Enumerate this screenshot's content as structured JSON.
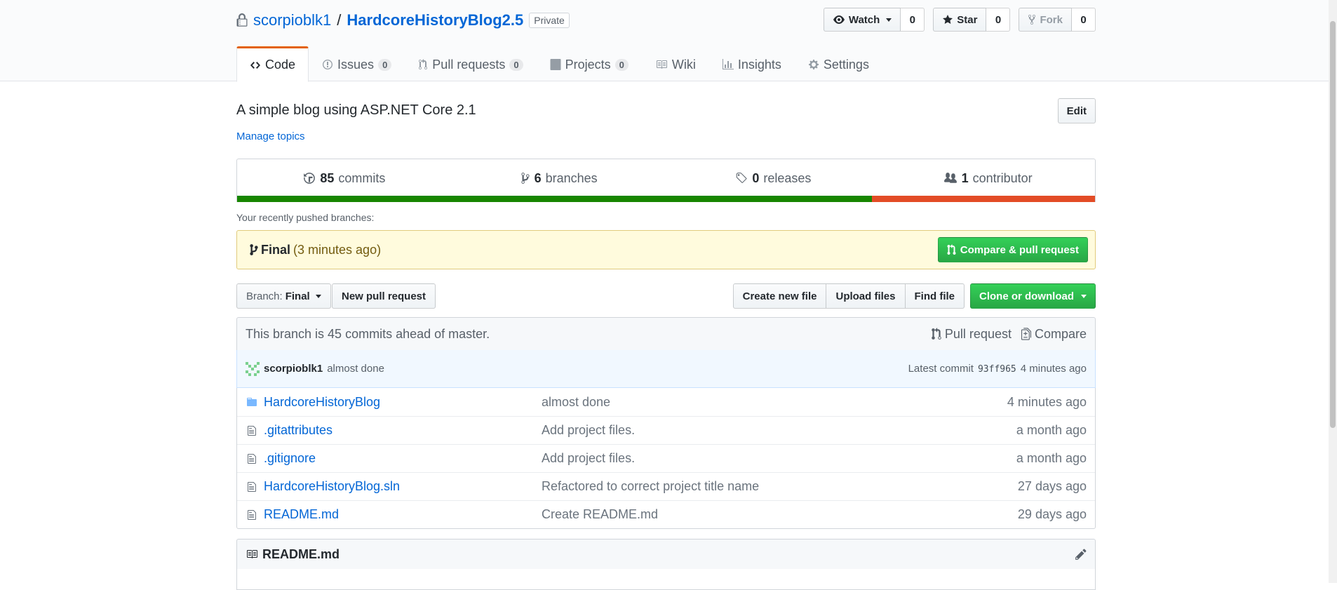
{
  "repo": {
    "owner": "scorpioblk1",
    "separator": "/",
    "name": "HardcoreHistoryBlog2.5",
    "visibility": "Private"
  },
  "actions": {
    "watch_label": "Watch",
    "watch_count": "0",
    "star_label": "Star",
    "star_count": "0",
    "fork_label": "Fork",
    "fork_count": "0"
  },
  "tabs": [
    {
      "label": "Code",
      "counter": null,
      "icon": "code-icon"
    },
    {
      "label": "Issues",
      "counter": "0",
      "icon": "issue-icon"
    },
    {
      "label": "Pull requests",
      "counter": "0",
      "icon": "pull-request-icon"
    },
    {
      "label": "Projects",
      "counter": "0",
      "icon": "project-icon"
    },
    {
      "label": "Wiki",
      "counter": null,
      "icon": "book-icon"
    },
    {
      "label": "Insights",
      "counter": null,
      "icon": "graph-icon"
    },
    {
      "label": "Settings",
      "counter": null,
      "icon": "gear-icon"
    }
  ],
  "about": {
    "description": "A simple blog using ASP.NET Core 2.1",
    "edit_label": "Edit",
    "manage_topics": "Manage topics"
  },
  "numbers": {
    "commits_count": "85",
    "commits_label": "commits",
    "branches_count": "6",
    "branches_label": "branches",
    "releases_count": "0",
    "releases_label": "releases",
    "contributors_count": "1",
    "contributors_label": "contributor"
  },
  "languages": [
    {
      "share": 74,
      "color": "#178600"
    },
    {
      "share": 26,
      "color": "#e34c26"
    }
  ],
  "recent": {
    "label": "Your recently pushed branches:",
    "branch": "Final",
    "time": "(3 minutes ago)",
    "compare_button": "Compare & pull request"
  },
  "file_nav": {
    "branch_prefix": "Branch:",
    "branch_name": "Final",
    "new_pull_request": "New pull request",
    "create_new_file": "Create new file",
    "upload_files": "Upload files",
    "find_file": "Find file",
    "clone_or_download": "Clone or download"
  },
  "branch_info": {
    "text": "This branch is 45 commits ahead of master.",
    "pull_request": "Pull request",
    "compare": "Compare"
  },
  "latest_commit": {
    "author": "scorpioblk1",
    "message": "almost done",
    "prefix": "Latest commit",
    "sha": "93ff965",
    "age": "4 minutes ago"
  },
  "files": [
    {
      "type": "folder",
      "name": "HardcoreHistoryBlog",
      "message": "almost done",
      "age": "4 minutes ago"
    },
    {
      "type": "file",
      "name": ".gitattributes",
      "message": "Add project files.",
      "age": "a month ago"
    },
    {
      "type": "file",
      "name": ".gitignore",
      "message": "Add project files.",
      "age": "a month ago"
    },
    {
      "type": "file",
      "name": "HardcoreHistoryBlog.sln",
      "message": "Refactored to correct project title name",
      "age": "27 days ago"
    },
    {
      "type": "file",
      "name": "README.md",
      "message": "Create README.md",
      "age": "29 days ago"
    }
  ],
  "readme": {
    "title": "README.md"
  }
}
